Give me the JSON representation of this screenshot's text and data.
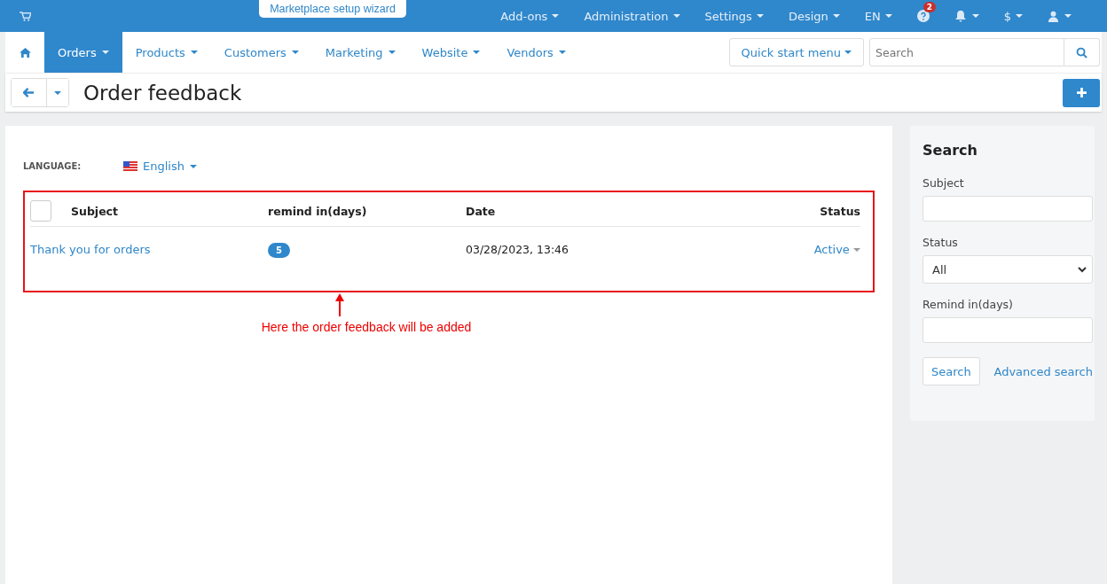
{
  "top_bar": {
    "wizard": "Marketplace setup wizard",
    "menu": [
      {
        "kind": "text",
        "label": "Add-ons"
      },
      {
        "kind": "text",
        "label": "Administration"
      },
      {
        "kind": "text",
        "label": "Settings"
      },
      {
        "kind": "text",
        "label": "Design"
      },
      {
        "kind": "text",
        "label": "EN"
      },
      {
        "kind": "help",
        "badge": "2"
      },
      {
        "kind": "bell"
      },
      {
        "kind": "text",
        "label": "$"
      },
      {
        "kind": "user"
      }
    ]
  },
  "nav": {
    "tabs": [
      {
        "label": "Orders",
        "selected": true
      },
      {
        "label": "Products",
        "selected": false
      },
      {
        "label": "Customers",
        "selected": false
      },
      {
        "label": "Marketing",
        "selected": false
      },
      {
        "label": "Website",
        "selected": false
      },
      {
        "label": "Vendors",
        "selected": false
      }
    ],
    "quick_start": "Quick start menu",
    "search": {
      "placeholder": "Search"
    }
  },
  "page": {
    "title": "Order feedback"
  },
  "language": {
    "label": "LANGUAGE:",
    "value": "English"
  },
  "table": {
    "select_all_checked": false,
    "columns": [
      "Subject",
      "remind in(days)",
      "Date",
      "Status"
    ],
    "rows": [
      {
        "subject": "Thank you for orders",
        "remind": "5",
        "date": "03/28/2023, 13:46",
        "status": "Active"
      }
    ]
  },
  "annotation": {
    "text": "Here the order feedback will be added"
  },
  "sidebar": {
    "title": "Search",
    "fields": [
      {
        "kind": "input",
        "label": "Subject"
      },
      {
        "kind": "select",
        "label": "Status",
        "value": "All"
      },
      {
        "kind": "input",
        "label": "Remind in(days)"
      }
    ],
    "search_button": "Search",
    "advanced_link": "Advanced search"
  }
}
